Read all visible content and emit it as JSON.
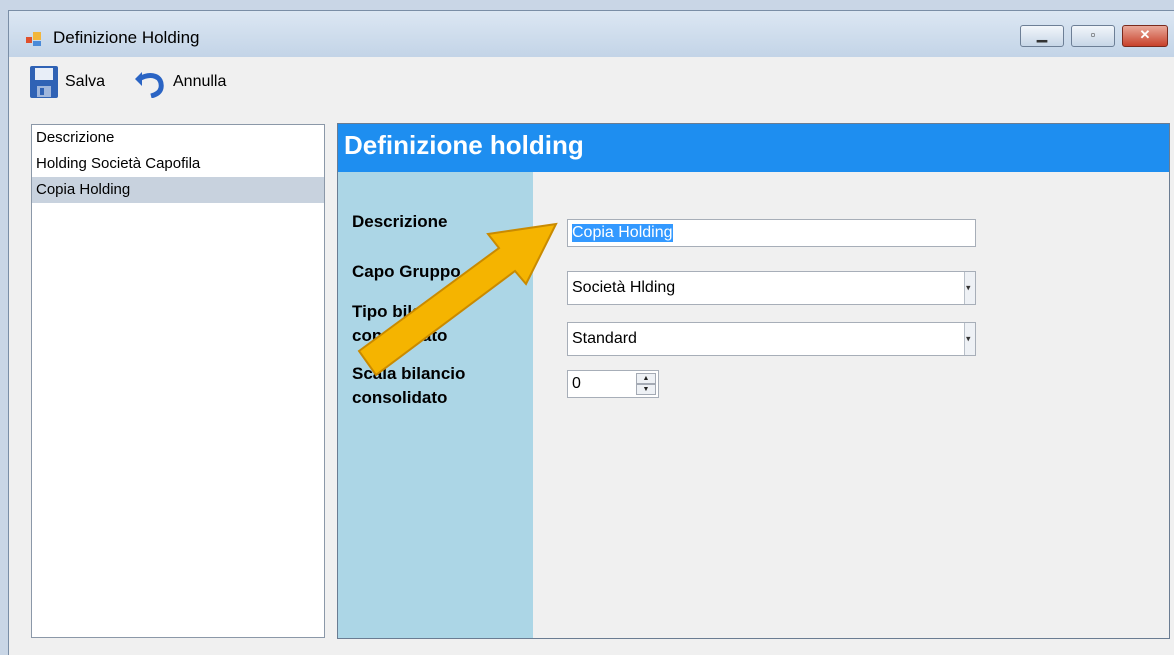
{
  "window": {
    "title": "Definizione Holding",
    "controls": {
      "minimize_icon": "minimize-icon",
      "maximize_icon": "maximize-icon",
      "close_icon": "close-icon"
    }
  },
  "toolbar": {
    "save_label": "Salva",
    "undo_label": "Annulla"
  },
  "sidebar": {
    "items": [
      {
        "label": "Descrizione"
      },
      {
        "label": "Holding Società Capofila"
      },
      {
        "label": "Copia Holding"
      }
    ],
    "selected": "Copia Holding"
  },
  "panel": {
    "title": "Definizione holding",
    "fields": {
      "descrizione_label": "Descrizione",
      "descrizione_value": "Copia Holding",
      "capo_gruppo_label": "Capo Gruppo",
      "capo_gruppo_value": "Società Hlding",
      "tipo_bilancio_label": "Tipo bilancio consolidato",
      "tipo_bilancio_value": "Standard",
      "scala_bilancio_label": "Scala bilancio consolidato",
      "scala_bilancio_value": "0"
    }
  },
  "annotation": {
    "icon": "pointer-arrow-icon",
    "color": "#f5b400"
  },
  "colors": {
    "header": "#1e8ef0",
    "label_column": "#acd6e6",
    "selection": "#3399ff"
  }
}
